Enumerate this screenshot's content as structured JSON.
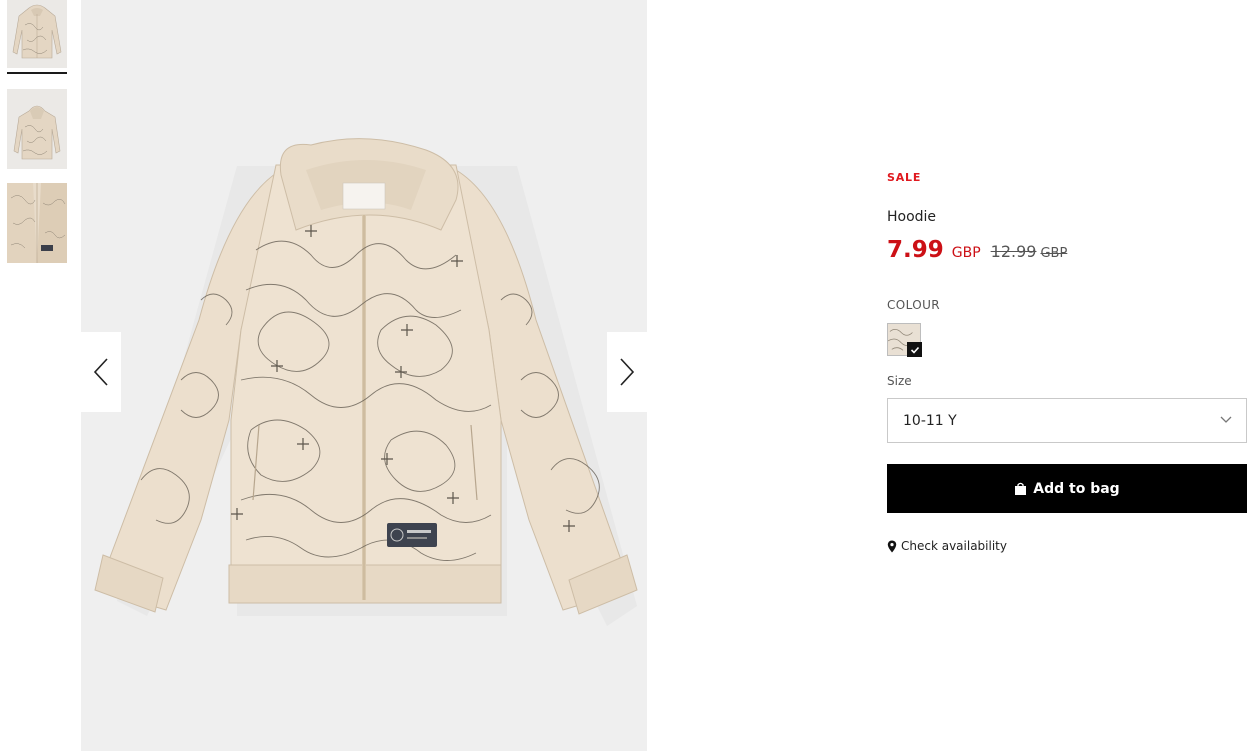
{
  "gallery": {
    "thumbnails": [
      {
        "name": "hoodie-front-thumbnail",
        "selected": true
      },
      {
        "name": "hoodie-back-thumbnail",
        "selected": false
      },
      {
        "name": "hoodie-detail-thumbnail",
        "selected": false
      }
    ],
    "prev_icon": "chevron-left-icon",
    "next_icon": "chevron-right-icon"
  },
  "product": {
    "badge": "SALE",
    "name": "Hoodie",
    "price_now": "7.99",
    "currency_now": "GBP",
    "price_old": "12.99",
    "currency_old": "GBP",
    "colour_label": "COLOUR",
    "size_label": "Size",
    "size_selected": "10-11 Y",
    "add_to_bag": "Add to bag",
    "check_availability": "Check availability"
  },
  "colors": {
    "sale_red": "#e0191f",
    "price_red": "#cc1016",
    "button_black": "#000000",
    "garment_beige": "#e9dccb"
  }
}
